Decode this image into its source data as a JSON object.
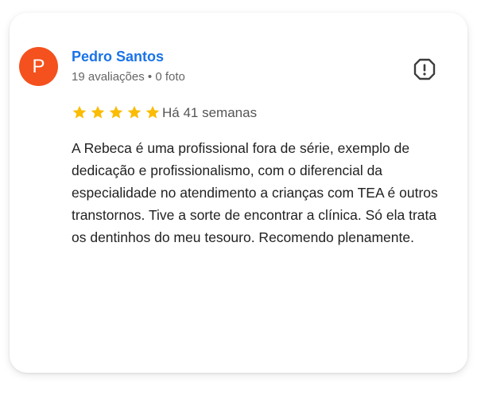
{
  "review": {
    "avatar_letter": "P",
    "avatar_color": "#f4511e",
    "author_name": "Pedro Santos",
    "author_meta": "19 avaliações • 0 foto",
    "rating": 5,
    "rating_max": 5,
    "star_color": "#fbbc04",
    "time_ago": "Há 41 semanas",
    "text": "A Rebeca é uma profissional fora de série, exemplo de dedicação e profissionalismo, com o diferencial da especialidade no atendimento a crianças com TEA é outros transtornos. Tive a sorte de encontrar a clínica. Só ela trata os dentinhos do meu tesouro. Recomendo plenamente.",
    "flag_icon": "report-flag-icon"
  }
}
